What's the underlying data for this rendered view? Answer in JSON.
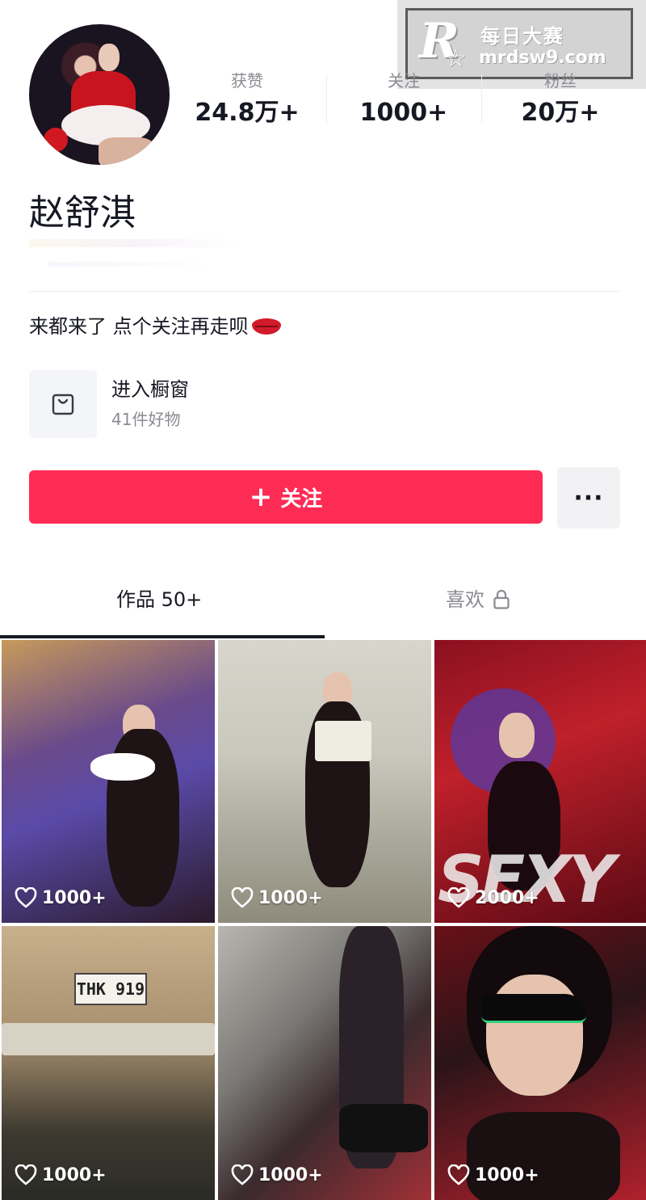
{
  "watermark": {
    "logo": "R",
    "title": "每日大赛",
    "url": "mrdsw9.com"
  },
  "profile": {
    "name": "赵舒淇",
    "bio": "来都来了 点个关注再走呗"
  },
  "stats": [
    {
      "label": "获赞",
      "value": "24.8万+"
    },
    {
      "label": "关注",
      "value": "1000+"
    },
    {
      "label": "粉丝",
      "value": "20万+"
    }
  ],
  "shop": {
    "title": "进入橱窗",
    "subtitle": "41件好物"
  },
  "actions": {
    "follow_icon": "+",
    "follow_label": "关注",
    "more_label": "···"
  },
  "tabs": [
    {
      "label": "作品 50+",
      "active": true
    },
    {
      "label": "喜欢",
      "locked": true
    }
  ],
  "videos": [
    {
      "likes": "1000+"
    },
    {
      "likes": "1000+"
    },
    {
      "likes": "2000+",
      "overlay_text": "SEXY"
    },
    {
      "likes": "1000+",
      "plate_text": "THK 919"
    },
    {
      "likes": "1000+"
    },
    {
      "likes": "1000+"
    }
  ],
  "colors": {
    "accent": "#fe2c55",
    "text": "#161823",
    "muted": "#8a8b91"
  },
  "icons": [
    "shopping-bag-icon",
    "lock-icon",
    "heart-icon",
    "more-icon",
    "plus-icon",
    "lips-emoji-icon"
  ]
}
